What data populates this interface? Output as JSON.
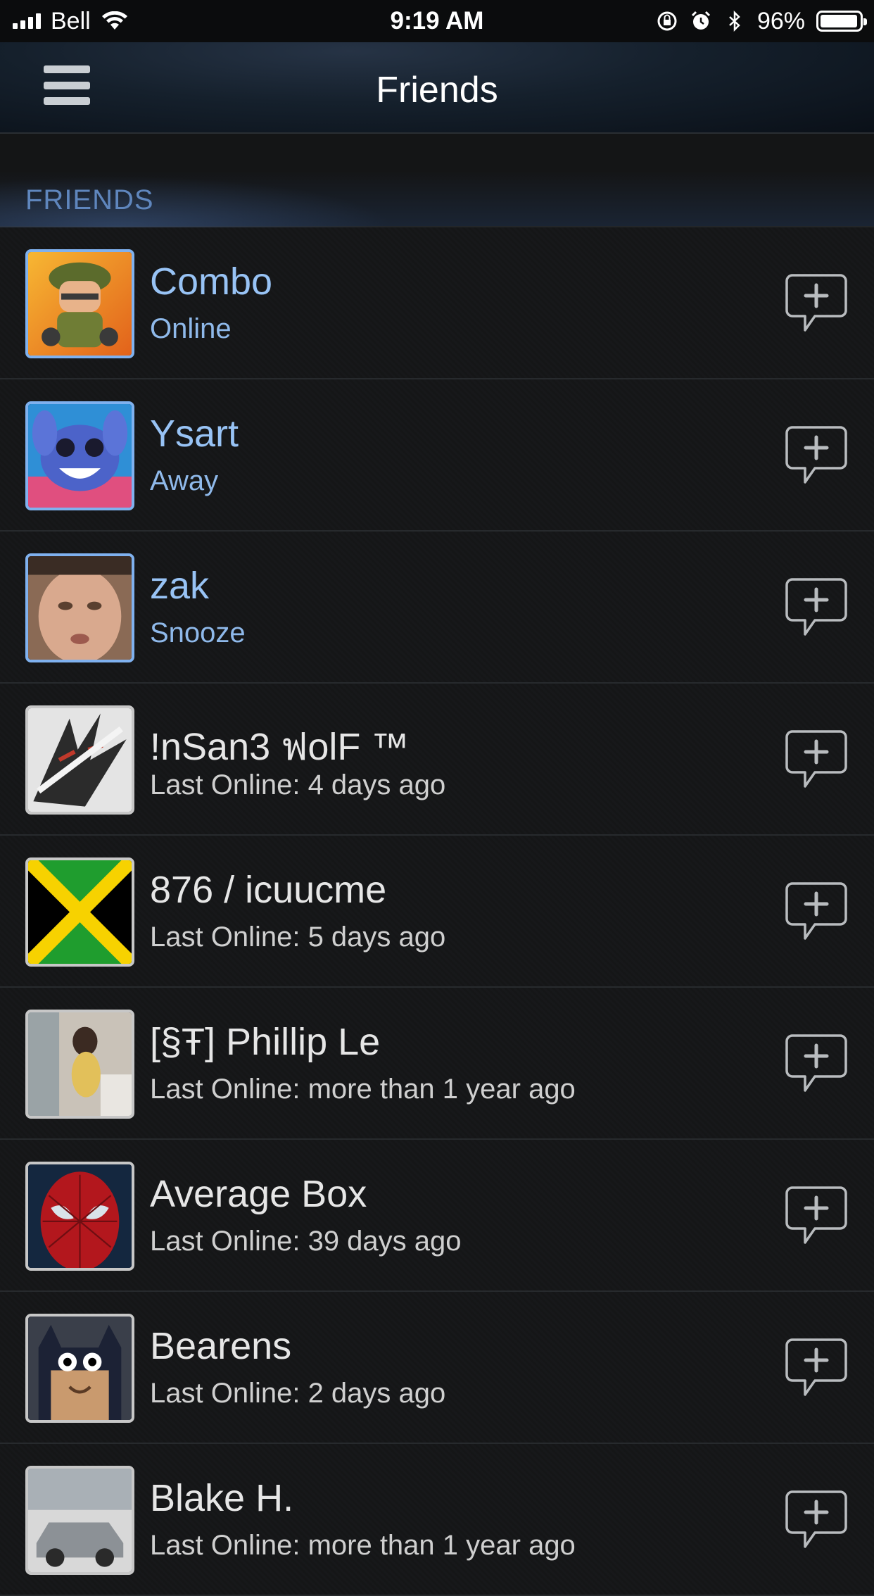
{
  "status_bar": {
    "carrier": "Bell",
    "time": "9:19 AM",
    "battery_percent": "96%",
    "battery_level": 0.96,
    "icons": [
      "signal-icon",
      "wifi-icon",
      "orientation-lock-icon",
      "alarm-icon",
      "bluetooth-icon",
      "battery-icon"
    ]
  },
  "nav": {
    "title": "Friends",
    "menu_icon": "hamburger-menu-icon"
  },
  "section": {
    "title": "FRIENDS"
  },
  "colors": {
    "online_name": "#98c3f5",
    "online_status": "#8fb9ea",
    "offline_name": "#e6e6e6",
    "section_title": "#5f86bd",
    "online_border": "#7fb1ef",
    "offline_border": "#c7c7c7"
  },
  "friends": [
    {
      "name": "Combo",
      "status": "Online",
      "online": true,
      "avatar": "soldier-avatar"
    },
    {
      "name": "Ysart",
      "status": "Away",
      "online": true,
      "avatar": "stitch-avatar"
    },
    {
      "name": "zak",
      "status": "Snooze",
      "online": true,
      "avatar": "face-photo-avatar"
    },
    {
      "name": "!nSan3 ฟolF ™",
      "status": "Last Online: 4 days ago",
      "online": false,
      "avatar": "wolf-avatar"
    },
    {
      "name": "876 / icuucme",
      "status": "Last Online: 5 days ago",
      "online": false,
      "avatar": "jamaica-flag-avatar"
    },
    {
      "name": "[§Ŧ] Phillip Le",
      "status": "Last Online: more than 1 year ago",
      "online": false,
      "avatar": "photo-avatar"
    },
    {
      "name": "Average Box",
      "status": "Last Online: 39 days ago",
      "online": false,
      "avatar": "spiderman-avatar"
    },
    {
      "name": "Bearens",
      "status": "Last Online: 2 days ago",
      "online": false,
      "avatar": "batman-avatar"
    },
    {
      "name": "Blake H.",
      "status": "Last Online: more than 1 year ago",
      "online": false,
      "avatar": "car-avatar"
    }
  ]
}
